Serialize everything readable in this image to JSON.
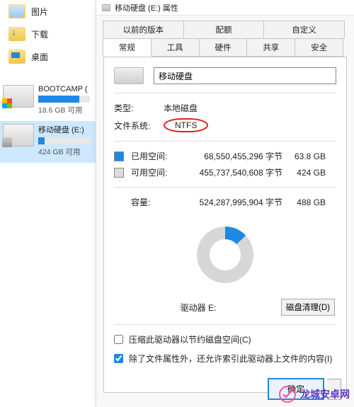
{
  "sidebar": {
    "nav": [
      {
        "label": "图片",
        "icon": "pictures"
      },
      {
        "label": "下载",
        "icon": "downloads"
      },
      {
        "label": "桌面",
        "icon": "desktop"
      }
    ],
    "drives": [
      {
        "name": "BOOTCAMP (",
        "free_text": "18.6 GB 可用",
        "fill_pct": 80,
        "selected": false,
        "kind": "win"
      },
      {
        "name": "移动硬盘 (E:)",
        "free_text": "424 GB 可用",
        "fill_pct": 13,
        "selected": true,
        "kind": "ext"
      }
    ]
  },
  "dialog": {
    "title": "移动硬盘 (E:) 属性",
    "tabs_row1": [
      "以前的版本",
      "配额",
      "自定义"
    ],
    "tabs_row2": [
      "常规",
      "工具",
      "硬件",
      "共享",
      "安全"
    ],
    "active_tab": "常规",
    "volume_name": "移动硬盘",
    "type_label": "类型:",
    "type_value": "本地磁盘",
    "fs_label": "文件系统:",
    "fs_value": "NTFS",
    "used_label": "已用空间:",
    "used_bytes": "68,550,455,296 字节",
    "used_human": "63.8 GB",
    "free_label": "可用空间:",
    "free_bytes": "455,737,540,608 字节",
    "free_human": "424 GB",
    "cap_label": "容量:",
    "cap_bytes": "524,287,995,904 字节",
    "cap_human": "488 GB",
    "drive_caption": "驱动器 E:",
    "cleanup_btn": "磁盘清理(D)",
    "cb_compress": "压缩此驱动器以节约磁盘空间(C)",
    "cb_index": "除了文件属性外，还允许索引此驱动器上文件的内容(I)",
    "ok_btn": "确定"
  },
  "watermark": {
    "text": "龙城安卓网"
  },
  "chart_data": {
    "type": "pie",
    "title": "驱动器 E:",
    "series": [
      {
        "name": "已用空间",
        "value": 63.8,
        "unit": "GB",
        "color": "#1e88e5"
      },
      {
        "name": "可用空间",
        "value": 424,
        "unit": "GB",
        "color": "#d7d7d7"
      }
    ],
    "total": {
      "label": "容量",
      "value": 488,
      "unit": "GB"
    }
  }
}
